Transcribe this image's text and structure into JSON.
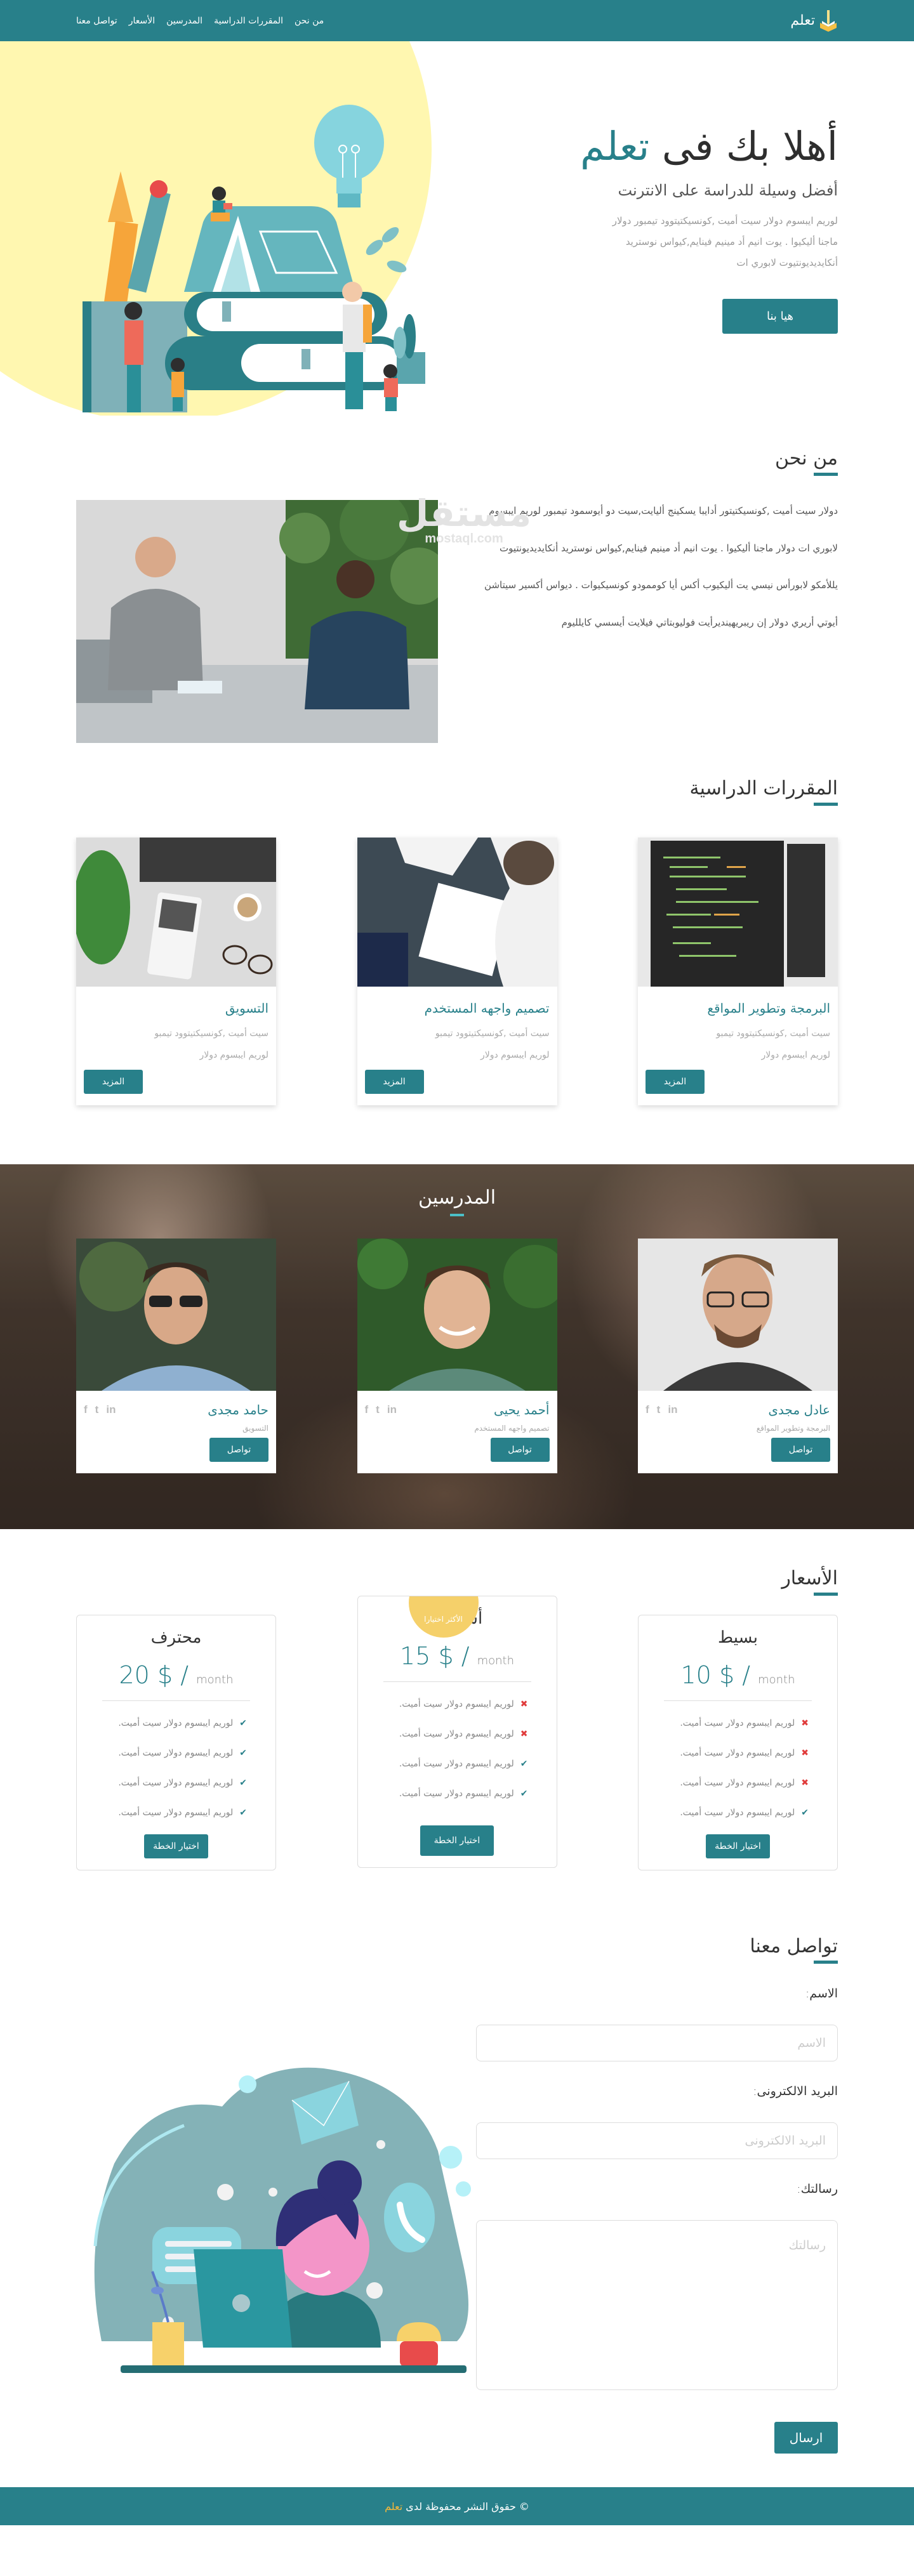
{
  "brand": {
    "name": "تعلم",
    "logo_icon": "book-pencil-logo"
  },
  "nav": {
    "items": [
      {
        "label": "من نحن"
      },
      {
        "label": "المقررات الدراسية"
      },
      {
        "label": "المدرسين"
      },
      {
        "label": "الأسعار"
      },
      {
        "label": "تواصل معنا"
      }
    ]
  },
  "hero": {
    "title_prefix": "أهلا بك فى",
    "title_accent": "تعلم",
    "subtitle": "أفضل وسيلة للدراسة على الانترنت",
    "description": "لوريم ايبسوم دولار سيت أميت ,كونسيكتيتوود تيمبور دولار ماجنا أليكيوا . يوت انيم أد مينيم فينايم,كيواس نوستريد أنكايديديونتيوت لابوري ات",
    "cta_label": "هيا بنا",
    "illustration": "family-books-illustration"
  },
  "about": {
    "title": "من نحن",
    "paragraphs": [
      "دولار سيت أميت ,كونسيكتيتور أدايبا يسكينج أليايت,سيت دو أيوسمود تيمبور لوريم ايبسوم",
      "لابوري ات دولار ماجنا أليكيوا . يوت انيم أد مينيم فينايم,كيواس نوستريد أنكايديديونتيوت",
      "يللأمكو لابورأس نيسي يت أليكيوب أكس أيا كوممودو كونسيكيوات . ديواس أكسير سيتاشن",
      "أيوتي أريري دولار إن ريبريهينديرأيت فوليوبتاتي فيلايت أيسسي كايلليوم"
    ],
    "image": "business-meeting-photo"
  },
  "courses": {
    "title": "المقررات الدراسية",
    "items": [
      {
        "title": "البرمجة وتطوير المواقع",
        "desc": "سيت أميت ,كونسيكتيتوود تيمبو لوريم ايبسوم دولار",
        "button": "المزيد",
        "image": "code-monitor-photo"
      },
      {
        "title": "تصميم واجهه المستخدم",
        "desc": "سيت أميت ,كونسيكتيتوود تيمبو لوريم ايبسوم دولار",
        "button": "المزيد",
        "image": "ui-sketch-photo"
      },
      {
        "title": "التسويق",
        "desc": "سيت أميت ,كونسيكتيتوود تيمبو لوريم ايبسوم دولار",
        "button": "المزيد",
        "image": "online-marketing-photo"
      }
    ]
  },
  "teachers": {
    "title": "المدرسين",
    "items": [
      {
        "name": "عادل مجدى",
        "role": "البرمجة وتطوير المواقع",
        "button": "تواصل",
        "social": [
          "f",
          "t",
          "in"
        ]
      },
      {
        "name": "أحمد يحيى",
        "role": "تصميم واجهه المستخدم",
        "button": "تواصل",
        "social": [
          "f",
          "t",
          "in"
        ]
      },
      {
        "name": "حامد مجدى",
        "role": "التسويق",
        "button": "تواصل",
        "social": [
          "f",
          "t",
          "in"
        ]
      }
    ]
  },
  "pricing": {
    "title": "الأسعار",
    "currency_suffix": "$ /",
    "period": "month",
    "badge": "الأكثر اختيارا",
    "plans": [
      {
        "name": "بسيط",
        "price": "10",
        "button": "اختيار الخطة",
        "features": [
          {
            "text": "لوريم ايبسوم دولار سيت أميت.",
            "included": false
          },
          {
            "text": "لوريم ايبسوم دولار سيت أميت.",
            "included": false
          },
          {
            "text": "لوريم ايبسوم دولار سيت أميت.",
            "included": false
          },
          {
            "text": "لوريم ايبسوم دولار سيت أميت.",
            "included": true
          }
        ]
      },
      {
        "name": "أساسى",
        "price": "15",
        "button": "اختيار الخطة",
        "featured": true,
        "features": [
          {
            "text": "لوريم ايبسوم دولار سيت أميت.",
            "included": false
          },
          {
            "text": "لوريم ايبسوم دولار سيت أميت.",
            "included": false
          },
          {
            "text": "لوريم ايبسوم دولار سيت أميت.",
            "included": true
          },
          {
            "text": "لوريم ايبسوم دولار سيت أميت.",
            "included": true
          }
        ]
      },
      {
        "name": "محترف",
        "price": "20",
        "button": "اختيار الخطة",
        "features": [
          {
            "text": "لوريم ايبسوم دولار سيت أميت.",
            "included": true
          },
          {
            "text": "لوريم ايبسوم دولار سيت أميت.",
            "included": true
          },
          {
            "text": "لوريم ايبسوم دولار سيت أميت.",
            "included": true
          },
          {
            "text": "لوريم ايبسوم دولار سيت أميت.",
            "included": true
          }
        ]
      }
    ]
  },
  "contact": {
    "title": "تواصل معنا",
    "name_label": "الاسم:",
    "name_placeholder": "الاسم",
    "name_value": "",
    "email_label": "البريد الالكترونى:",
    "email_placeholder": "البريد الالكترونى",
    "email_value": "",
    "message_label": "رسالتك:",
    "message_placeholder": "رسالتك",
    "message_value": "",
    "submit": "ارسال",
    "illustration": "support-agent-illustration"
  },
  "watermark": {
    "ar": "مستقل",
    "en": "mostaql.com"
  },
  "footer": {
    "copyright": "© حقوق النشر محفوظة لدى",
    "brand": "تعلم"
  },
  "colors": {
    "primary": "#28808a",
    "accent_yellow": "#f5d06a",
    "hero_blob": "#fff7b0",
    "error": "#e03c3c",
    "footer_brand": "#f5b83a"
  }
}
